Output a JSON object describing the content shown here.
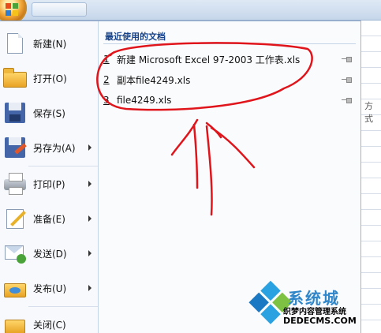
{
  "menu": {
    "items": [
      {
        "label": "新建(N)",
        "icon": "new-document-icon",
        "submenu": false
      },
      {
        "label": "打开(O)",
        "icon": "open-folder-icon",
        "submenu": false
      },
      {
        "label": "保存(S)",
        "icon": "save-disk-icon",
        "submenu": false
      },
      {
        "label": "另存为(A)",
        "icon": "save-as-icon",
        "submenu": true
      },
      {
        "label": "打印(P)",
        "icon": "printer-icon",
        "submenu": true
      },
      {
        "label": "准备(E)",
        "icon": "prepare-document-icon",
        "submenu": true
      },
      {
        "label": "发送(D)",
        "icon": "send-mail-icon",
        "submenu": true
      },
      {
        "label": "发布(U)",
        "icon": "publish-icon",
        "submenu": true
      },
      {
        "label": "关闭(C)",
        "icon": "close-folder-icon",
        "submenu": false
      }
    ]
  },
  "recent": {
    "title": "最近使用的文档",
    "documents": [
      {
        "index": "1",
        "name": "新建 Microsoft Excel 97-2003 工作表.xls"
      },
      {
        "index": "2",
        "name": "副本file4249.xls"
      },
      {
        "index": "3",
        "name": "file4249.xls"
      }
    ]
  },
  "background": {
    "ribbon_tab_text": "方式"
  },
  "watermark": {
    "big": "系统城",
    "sub": "织梦内容管理系统",
    "url": "DEDECMS.COM"
  },
  "colors": {
    "annotation": "#e0141b",
    "accent": "#15428b"
  }
}
